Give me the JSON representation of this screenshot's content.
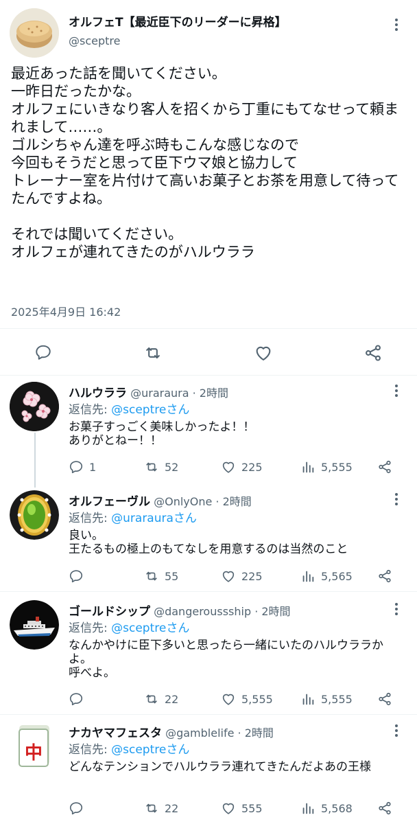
{
  "main_tweet": {
    "name": "オルフェT【最近臣下のリーダーに昇格】",
    "handle": "@sceptre",
    "text": "最近あった話を聞いてください。\n一昨日だったかな。\nオルフェにいきなり客人を招くから丁重にもてなせって頼まれまして……。\nゴルシちゃん達を呼ぶ時もこんな感じなので\n今回もそうだと思って臣下ウマ娘と協力して\nトレーナー室を片付けて高いお菓子とお茶を用意して待ってたんですよね。\n\nそれでは聞いてください。\nオルフェが連れてきたのがハルウララ",
    "timestamp": "2025年4月9日 16:42"
  },
  "replies": [
    {
      "name": "ハルウララ",
      "handle": "@uraraura",
      "time": "· 2時間",
      "reply_prefix": "返信先: ",
      "reply_to": "@sceptreさん",
      "text": "お菓子すっごく美味しかったよ！！\nありがとねー！！",
      "replies_count": "1",
      "retweets": "52",
      "likes": "225",
      "views": "5,555"
    },
    {
      "name": "オルフェーヴル",
      "handle": "@OnlyOne",
      "time": "· 2時間",
      "reply_prefix": "返信先: ",
      "reply_to": "@urarauraさん",
      "text": "良い。\n王たるもの極上のもてなしを用意するのは当然のこと",
      "replies_count": "",
      "retweets": "55",
      "likes": "225",
      "views": "5,565"
    },
    {
      "name": "ゴールドシップ",
      "handle": "@dangeroussship",
      "time": "· 2時間",
      "reply_prefix": "返信先: ",
      "reply_to": "@sceptreさん",
      "text": "なんかやけに臣下多いと思ったら一緒にいたのハルウララかよ。\n呼べよ。",
      "replies_count": "",
      "retweets": "22",
      "likes": "5,555",
      "views": "5,555"
    },
    {
      "name": "ナカヤマフェスタ",
      "handle": "@gamblelife",
      "time": "· 2時間",
      "reply_prefix": "返信先: ",
      "reply_to": "@sceptreさん",
      "text": "どんなテンションでハルウララ連れてきたんだよあの王様",
      "replies_count": "",
      "retweets": "22",
      "likes": "555",
      "views": "5,568"
    }
  ],
  "mahjong_tile_char": "中",
  "colors": {
    "text": "#0f1419",
    "secondary": "#536471",
    "link": "#1d9bf0",
    "divider": "#eff3f4"
  },
  "icons": [
    "more-icon",
    "reply-icon",
    "retweet-icon",
    "like-icon",
    "share-icon",
    "views-icon"
  ]
}
